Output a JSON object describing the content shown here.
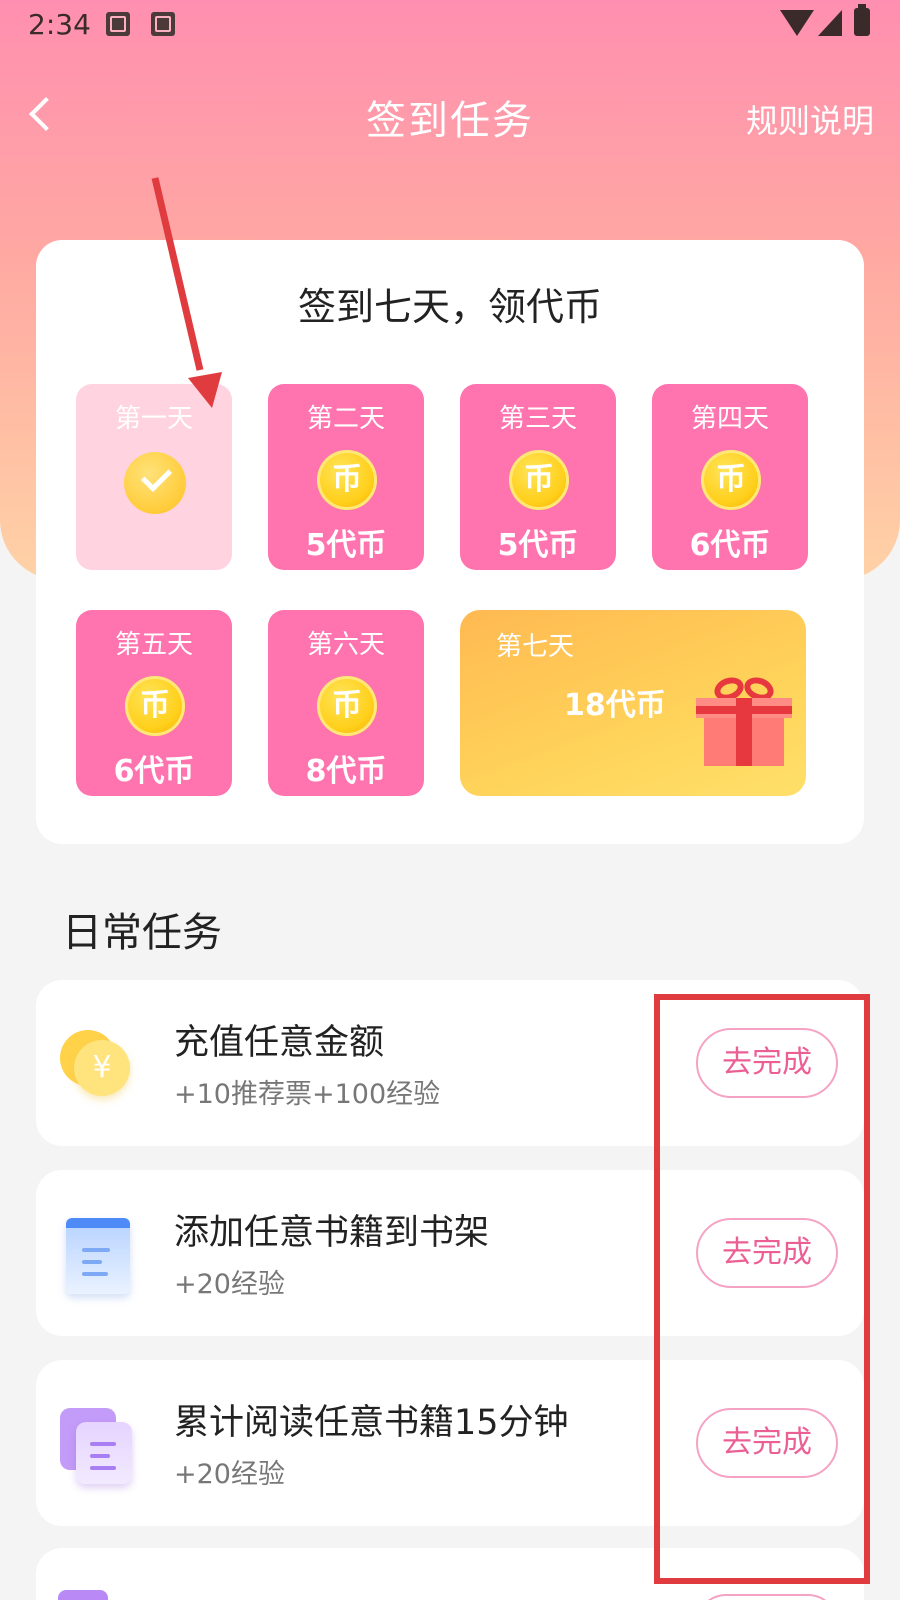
{
  "status_bar": {
    "time": "2:34",
    "icons": [
      "image-icon",
      "text-a-icon",
      "wifi-icon",
      "signal-icon",
      "battery-charging-icon"
    ]
  },
  "header": {
    "title": "签到任务",
    "rules_label": "规则说明",
    "back_icon": "chevron-left-icon"
  },
  "checkin": {
    "title": "签到七天，领代币",
    "days": [
      {
        "label": "第一天",
        "reward": "",
        "status": "checked"
      },
      {
        "label": "第二天",
        "reward": "5代币",
        "coin_glyph": "币"
      },
      {
        "label": "第三天",
        "reward": "5代币",
        "coin_glyph": "币"
      },
      {
        "label": "第四天",
        "reward": "6代币",
        "coin_glyph": "币"
      },
      {
        "label": "第五天",
        "reward": "6代币",
        "coin_glyph": "币"
      },
      {
        "label": "第六天",
        "reward": "8代币",
        "coin_glyph": "币"
      },
      {
        "label": "第七天",
        "reward": "18代币",
        "icon": "gift-box-icon"
      }
    ]
  },
  "daily": {
    "section_title": "日常任务",
    "tasks": [
      {
        "title": "充值任意金额",
        "subtitle": "+10推荐票+100经验",
        "button": "去完成",
        "icon": "coin-yen-icon",
        "icon_glyph": "¥"
      },
      {
        "title": "添加任意书籍到书架",
        "subtitle": "+20经验",
        "button": "去完成",
        "icon": "book-icon"
      },
      {
        "title": "累计阅读任意书籍15分钟",
        "subtitle": "+20经验",
        "button": "去完成",
        "icon": "reading-pages-icon"
      }
    ]
  },
  "colors": {
    "accent_pink": "#ff74ae",
    "button_text": "#ec5f95",
    "annotation_red": "#e03b3f",
    "day7_gold": "#ffc654"
  }
}
